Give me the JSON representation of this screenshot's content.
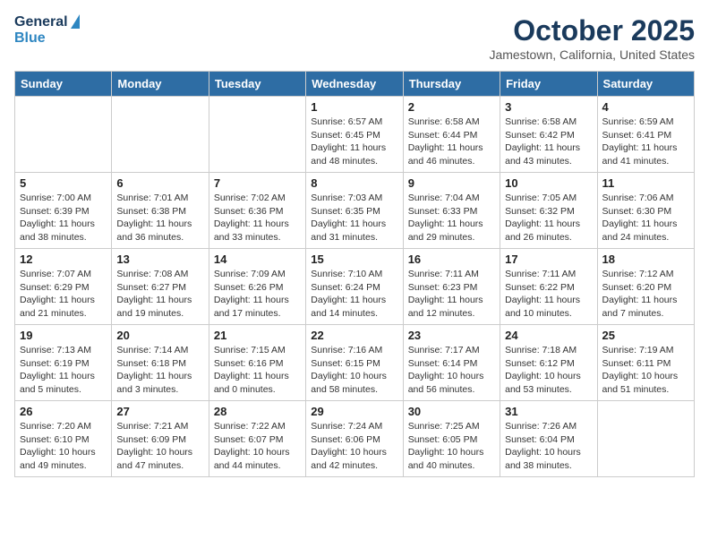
{
  "header": {
    "logo_line1": "General",
    "logo_line2": "Blue",
    "month": "October 2025",
    "location": "Jamestown, California, United States"
  },
  "days_of_week": [
    "Sunday",
    "Monday",
    "Tuesday",
    "Wednesday",
    "Thursday",
    "Friday",
    "Saturday"
  ],
  "weeks": [
    [
      {
        "day": "",
        "info": ""
      },
      {
        "day": "",
        "info": ""
      },
      {
        "day": "",
        "info": ""
      },
      {
        "day": "1",
        "info": "Sunrise: 6:57 AM\nSunset: 6:45 PM\nDaylight: 11 hours\nand 48 minutes."
      },
      {
        "day": "2",
        "info": "Sunrise: 6:58 AM\nSunset: 6:44 PM\nDaylight: 11 hours\nand 46 minutes."
      },
      {
        "day": "3",
        "info": "Sunrise: 6:58 AM\nSunset: 6:42 PM\nDaylight: 11 hours\nand 43 minutes."
      },
      {
        "day": "4",
        "info": "Sunrise: 6:59 AM\nSunset: 6:41 PM\nDaylight: 11 hours\nand 41 minutes."
      }
    ],
    [
      {
        "day": "5",
        "info": "Sunrise: 7:00 AM\nSunset: 6:39 PM\nDaylight: 11 hours\nand 38 minutes."
      },
      {
        "day": "6",
        "info": "Sunrise: 7:01 AM\nSunset: 6:38 PM\nDaylight: 11 hours\nand 36 minutes."
      },
      {
        "day": "7",
        "info": "Sunrise: 7:02 AM\nSunset: 6:36 PM\nDaylight: 11 hours\nand 33 minutes."
      },
      {
        "day": "8",
        "info": "Sunrise: 7:03 AM\nSunset: 6:35 PM\nDaylight: 11 hours\nand 31 minutes."
      },
      {
        "day": "9",
        "info": "Sunrise: 7:04 AM\nSunset: 6:33 PM\nDaylight: 11 hours\nand 29 minutes."
      },
      {
        "day": "10",
        "info": "Sunrise: 7:05 AM\nSunset: 6:32 PM\nDaylight: 11 hours\nand 26 minutes."
      },
      {
        "day": "11",
        "info": "Sunrise: 7:06 AM\nSunset: 6:30 PM\nDaylight: 11 hours\nand 24 minutes."
      }
    ],
    [
      {
        "day": "12",
        "info": "Sunrise: 7:07 AM\nSunset: 6:29 PM\nDaylight: 11 hours\nand 21 minutes."
      },
      {
        "day": "13",
        "info": "Sunrise: 7:08 AM\nSunset: 6:27 PM\nDaylight: 11 hours\nand 19 minutes."
      },
      {
        "day": "14",
        "info": "Sunrise: 7:09 AM\nSunset: 6:26 PM\nDaylight: 11 hours\nand 17 minutes."
      },
      {
        "day": "15",
        "info": "Sunrise: 7:10 AM\nSunset: 6:24 PM\nDaylight: 11 hours\nand 14 minutes."
      },
      {
        "day": "16",
        "info": "Sunrise: 7:11 AM\nSunset: 6:23 PM\nDaylight: 11 hours\nand 12 minutes."
      },
      {
        "day": "17",
        "info": "Sunrise: 7:11 AM\nSunset: 6:22 PM\nDaylight: 11 hours\nand 10 minutes."
      },
      {
        "day": "18",
        "info": "Sunrise: 7:12 AM\nSunset: 6:20 PM\nDaylight: 11 hours\nand 7 minutes."
      }
    ],
    [
      {
        "day": "19",
        "info": "Sunrise: 7:13 AM\nSunset: 6:19 PM\nDaylight: 11 hours\nand 5 minutes."
      },
      {
        "day": "20",
        "info": "Sunrise: 7:14 AM\nSunset: 6:18 PM\nDaylight: 11 hours\nand 3 minutes."
      },
      {
        "day": "21",
        "info": "Sunrise: 7:15 AM\nSunset: 6:16 PM\nDaylight: 11 hours\nand 0 minutes."
      },
      {
        "day": "22",
        "info": "Sunrise: 7:16 AM\nSunset: 6:15 PM\nDaylight: 10 hours\nand 58 minutes."
      },
      {
        "day": "23",
        "info": "Sunrise: 7:17 AM\nSunset: 6:14 PM\nDaylight: 10 hours\nand 56 minutes."
      },
      {
        "day": "24",
        "info": "Sunrise: 7:18 AM\nSunset: 6:12 PM\nDaylight: 10 hours\nand 53 minutes."
      },
      {
        "day": "25",
        "info": "Sunrise: 7:19 AM\nSunset: 6:11 PM\nDaylight: 10 hours\nand 51 minutes."
      }
    ],
    [
      {
        "day": "26",
        "info": "Sunrise: 7:20 AM\nSunset: 6:10 PM\nDaylight: 10 hours\nand 49 minutes."
      },
      {
        "day": "27",
        "info": "Sunrise: 7:21 AM\nSunset: 6:09 PM\nDaylight: 10 hours\nand 47 minutes."
      },
      {
        "day": "28",
        "info": "Sunrise: 7:22 AM\nSunset: 6:07 PM\nDaylight: 10 hours\nand 44 minutes."
      },
      {
        "day": "29",
        "info": "Sunrise: 7:24 AM\nSunset: 6:06 PM\nDaylight: 10 hours\nand 42 minutes."
      },
      {
        "day": "30",
        "info": "Sunrise: 7:25 AM\nSunset: 6:05 PM\nDaylight: 10 hours\nand 40 minutes."
      },
      {
        "day": "31",
        "info": "Sunrise: 7:26 AM\nSunset: 6:04 PM\nDaylight: 10 hours\nand 38 minutes."
      },
      {
        "day": "",
        "info": ""
      }
    ]
  ]
}
